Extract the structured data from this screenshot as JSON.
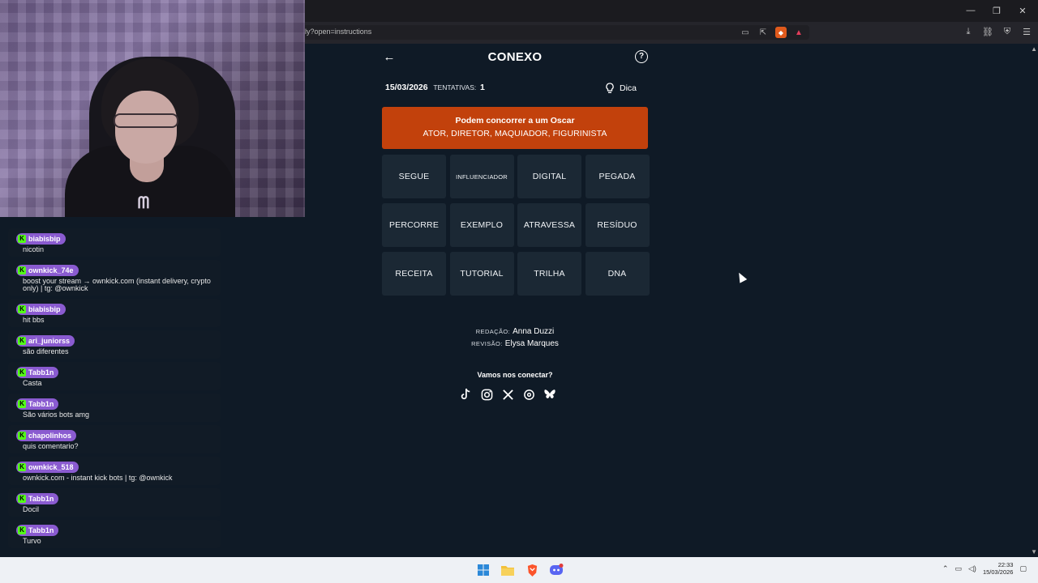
{
  "browser": {
    "url": "ly?open=instructions"
  },
  "chat": {
    "messages": [
      {
        "user": "biabisbip",
        "text": "nicotin"
      },
      {
        "user": "ownkick_74e",
        "text": "boost your stream → ownkick.com (instant delivery, crypto only) | tg: @ownkick"
      },
      {
        "user": "biabisbip",
        "text": "hit bbs"
      },
      {
        "user": "ari_juniorss",
        "text": "são diferentes"
      },
      {
        "user": "Tabb1n",
        "text": "Casta"
      },
      {
        "user": "Tabb1n",
        "text": "São vários bots amg"
      },
      {
        "user": "chapolinhos",
        "text": "quis comentario?"
      },
      {
        "user": "ownkick_518",
        "text": "ownkick.com - instant kick bots | tg: @ownkick"
      },
      {
        "user": "Tabb1n",
        "text": "Docil"
      },
      {
        "user": "Tabb1n",
        "text": "Turvo"
      }
    ],
    "badge": "K"
  },
  "game": {
    "title": "CONEXO",
    "date": "15/03/2026",
    "tries_label": "TENTATIVAS:",
    "tries": "1",
    "hint_label": "Dica",
    "solved_group": {
      "title": "Podem concorrer a um Oscar",
      "words": "ATOR, DIRETOR, MAQUIADOR, FIGURINISTA"
    },
    "tiles": [
      "SEGUE",
      "INFLUENCIADOR",
      "DIGITAL",
      "PEGADA",
      "PERCORRE",
      "EXEMPLO",
      "ATRAVESSA",
      "RESÍDUO",
      "RECEITA",
      "TUTORIAL",
      "TRILHA",
      "DNA"
    ],
    "credits": {
      "redacao_label": "REDAÇÃO:",
      "redacao_name": "Anna Duzzi",
      "revisao_label": "REVISÃO:",
      "revisao_name": "Elysa Marques"
    },
    "connect_label": "Vamos nos conectar?"
  },
  "taskbar": {
    "time": "22:33",
    "date": "15/03/2026"
  },
  "colors": {
    "page_bg": "#0f1a26",
    "tile_bg": "#1b2834",
    "solved_bg": "#c2410c",
    "chat_user_badge": "#8a5bd0",
    "kick_green": "#53fc18"
  },
  "icons": [
    "back-arrow-icon",
    "help-icon",
    "bulb-icon",
    "tiktok-icon",
    "instagram-icon",
    "x-icon",
    "threads-icon",
    "bluesky-icon"
  ]
}
